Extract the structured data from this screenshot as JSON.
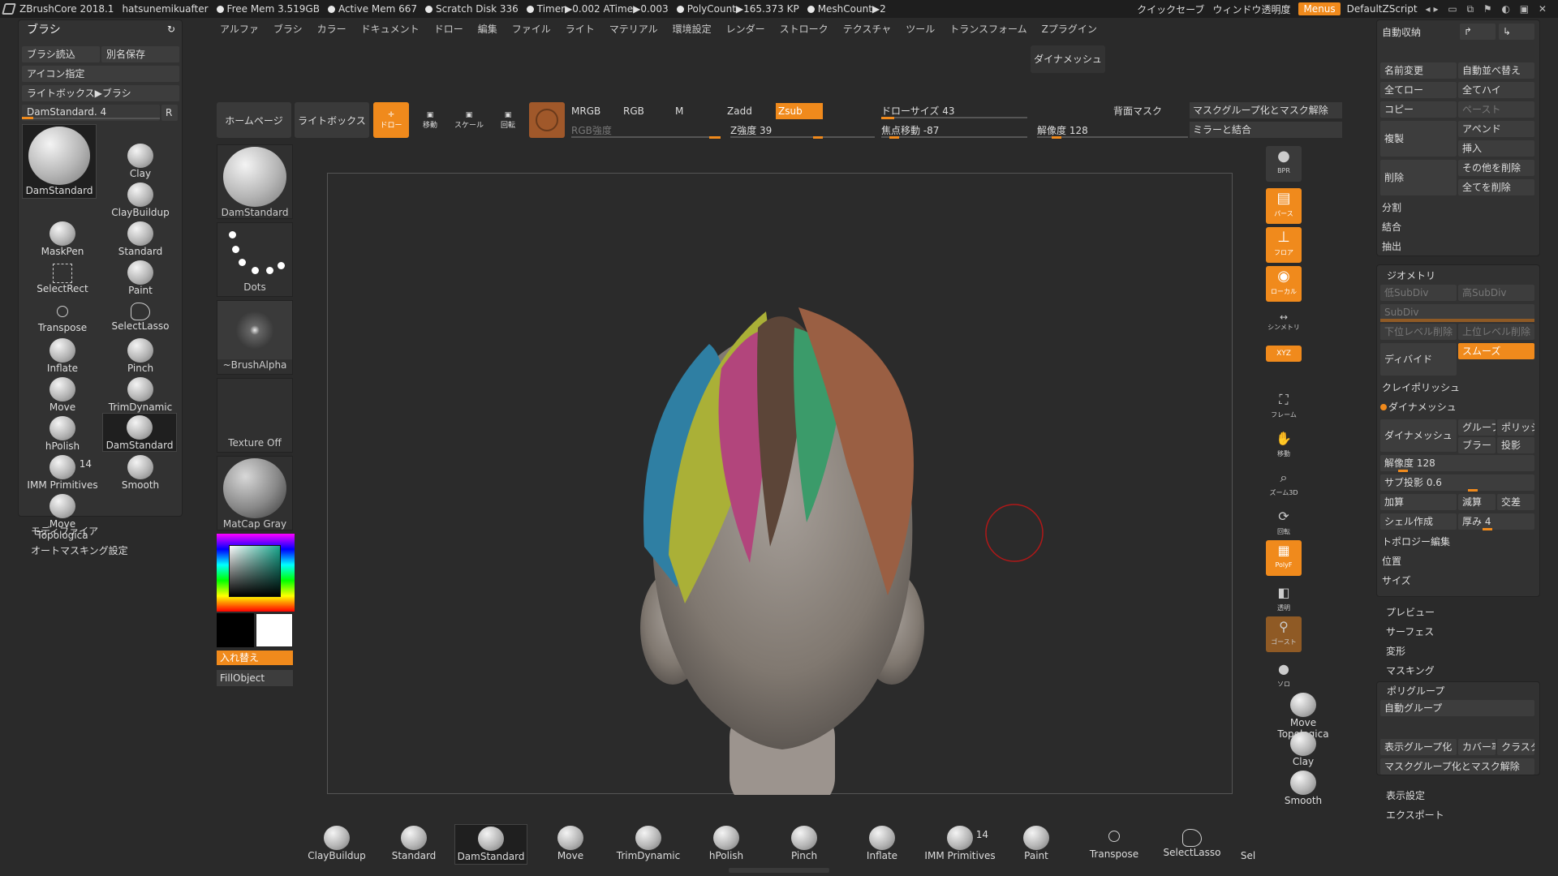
{
  "topbar": {
    "app": "ZBrushCore 2018.1",
    "user": "hatsunemikuafter",
    "free_mem": "Free Mem 3.519GB",
    "active_mem": "Active Mem 667",
    "scratch": "Scratch Disk 336",
    "timer": "Timer▶0.002 ATime▶0.003",
    "polycount": "PolyCount▶165.373 KP",
    "meshcount": "MeshCount▶2",
    "quicksave": "クイックセーブ",
    "transparency": "ウィンドウ透明度",
    "menus": "Menus",
    "script": "DefaultZScript"
  },
  "menu": [
    "アルファ",
    "ブラシ",
    "カラー",
    "ドキュメント",
    "ドロー",
    "編集",
    "ファイル",
    "ライト",
    "マテリアル",
    "環境設定",
    "レンダー",
    "ストローク",
    "テクスチャ",
    "ツール",
    "トランスフォーム",
    "Zプラグイン"
  ],
  "dynamesh_top": "ダイナメッシュ",
  "left": {
    "title": "ブラシ",
    "load": "ブラシ読込",
    "save_as": "別名保存",
    "icon": "アイコン指定",
    "lightbox_brush": "ライトボックス▶ブラシ",
    "current": "DamStandard. 4",
    "r": "R",
    "brushes": [
      "DamStandard",
      "Clay",
      "ClayBuildup",
      "MaskPen",
      "Standard",
      "SelectRect",
      "Paint",
      "Transpose",
      "SelectLasso",
      "Inflate",
      "Pinch",
      "Move",
      "TrimDynamic",
      "hPolish",
      "DamStandard",
      "IMM Primitives",
      "Smooth",
      "Move Topologica"
    ],
    "imm_count": "14",
    "modifier": "モディファイア",
    "automask": "オートマスキング設定"
  },
  "col2": {
    "brush": "DamStandard",
    "dots": "Dots",
    "alpha": "~BrushAlpha",
    "texture": "Texture Off",
    "material": "MatCap Gray",
    "swap": "入れ替え",
    "fill": "FillObject"
  },
  "toolbar": {
    "home": "ホームページ",
    "lightbox": "ライトボックス",
    "draw": "ドロー",
    "move": "移動",
    "scale": "スケール",
    "rotate": "回転",
    "mrgb": "MRGB",
    "rgb": "RGB",
    "m": "M",
    "zadd": "Zadd",
    "zsub": "Zsub",
    "rgb_intensity": "RGB強度",
    "z_intensity": "Z強度 39",
    "draw_size": "ドローサイズ 43",
    "focal": "焦点移動 -87",
    "resolution": "解像度 128",
    "backface": "背面マスク",
    "mask_group": "マスクグループ化とマスク解除",
    "mirror": "ミラーと結合"
  },
  "rshelf": [
    "BPR",
    "パース",
    "フロア",
    "ローカル",
    "シンメトリ",
    "XYZ",
    "フレーム",
    "移動",
    "ズーム3D",
    "回転",
    "PolyF",
    "透明",
    "ゴースト",
    "ソロ"
  ],
  "rshelf_brushes": [
    "Move Topologica",
    "Clay",
    "Smooth"
  ],
  "right": {
    "autosave": "自動収納",
    "rename": "名前変更",
    "autosort": "自動並べ替え",
    "all_low": "全てロー",
    "all_high": "全てハイ",
    "copy": "コピー",
    "paste": "ペースト",
    "duplicate": "複製",
    "append": "アペンド",
    "insert": "挿入",
    "delete": "削除",
    "del_other": "その他を削除",
    "del_all": "全てを削除",
    "split": "分割",
    "merge": "結合",
    "extract": "抽出",
    "geometry": "ジオメトリ",
    "low_subdiv": "低SubDiv",
    "high_subdiv": "高SubDiv",
    "subdiv": "SubDiv",
    "del_lower": "下位レベル削除",
    "del_higher": "上位レベル削除",
    "divide": "ディバイド",
    "smooth": "スムーズ",
    "claypolish": "クレイポリッシュ",
    "dynamesh_head": "ダイナメッシュ",
    "dynamesh": "ダイナメッシュ",
    "group": "グループ",
    "polish": "ポリッシュ",
    "blur": "ブラー",
    "project": "投影",
    "resolution": "解像度 128",
    "subproj": "サブ投影 0.6",
    "add": "加算",
    "sub": "減算",
    "intersect": "交差",
    "shell": "シェル作成",
    "thickness": "厚み 4",
    "topology": "トポロジー編集",
    "position": "位置",
    "size": "サイズ",
    "preview": "プレビュー",
    "surface": "サーフェス",
    "deform": "変形",
    "masking": "マスキング",
    "polygroup": "ポリグループ",
    "autogroup": "自動グループ",
    "visible_group": "表示グループ化",
    "coverage": "カバー率",
    "cluster": "クラスタ",
    "mask_group": "マスクグループ化とマスク解除",
    "display": "表示設定",
    "export": "エクスポート"
  },
  "bottom": [
    "ClayBuildup",
    "Standard",
    "DamStandard",
    "Move",
    "TrimDynamic",
    "hPolish",
    "Pinch",
    "Inflate",
    "IMM Primitives",
    "Paint",
    "Transpose",
    "SelectLasso",
    "Sel"
  ],
  "bottom_imm_count": "14",
  "colors": {
    "accent": "#f08a1c",
    "canvas": "#2b2b2b",
    "panel": "#323232"
  }
}
